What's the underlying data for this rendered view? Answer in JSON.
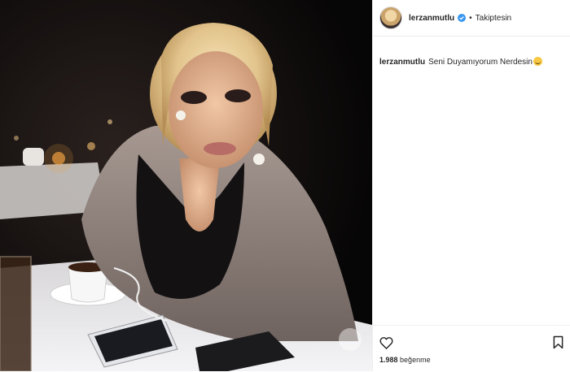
{
  "post": {
    "username": "lerzanmutlu",
    "verified": true,
    "separator": "•",
    "follow_status": "Takiptesin",
    "caption": {
      "username": "lerzanmutlu",
      "text": "Seni Duyamıyorum Nerdesin",
      "emoji": "grinning-sweat-emoji"
    },
    "likes": {
      "count": "1.988",
      "label": "beğenme"
    },
    "photo": {
      "description_icon": "photo"
    }
  },
  "colors": {
    "verified_blue": "#3897f0",
    "text": "#262626",
    "divider": "#efefef"
  },
  "icons": [
    "heart-icon",
    "bookmark-icon",
    "verified-badge-icon"
  ]
}
